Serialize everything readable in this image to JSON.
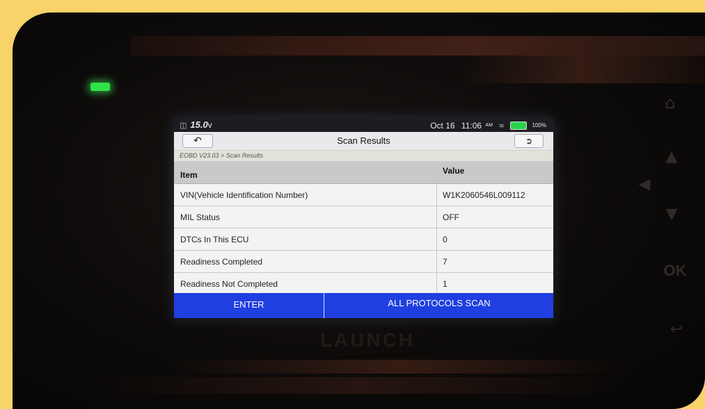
{
  "device": {
    "brand": "LAUNCH",
    "led_color": "#34e24a",
    "buttons": [
      {
        "name": "home",
        "icon": "home-icon",
        "glyph": "⌂"
      },
      {
        "name": "up",
        "icon": "arrow-up-icon",
        "glyph": "▲"
      },
      {
        "name": "left",
        "icon": "arrow-left-icon",
        "glyph": "◀"
      },
      {
        "name": "down",
        "icon": "arrow-down-icon",
        "glyph": "▼"
      },
      {
        "name": "ok",
        "label": "OK"
      },
      {
        "name": "back",
        "icon": "back-arrow-icon",
        "glyph": "↩"
      }
    ]
  },
  "screen": {
    "status_bar": {
      "battery_icon": "car-battery-icon",
      "voltage": "15.0",
      "voltage_unit": "v",
      "date": "Oct 16",
      "time": "11:06",
      "ampm": "AM",
      "wifi_icon": "wifi-icon",
      "battery_level": "100%",
      "battery_color": "#2bd24a"
    },
    "title_bar": {
      "back_icon": "back-arrow-icon",
      "title": "Scan Results",
      "exit_icon": "exit-icon"
    },
    "breadcrumb": "EOBD V23.03 > Scan Results",
    "table": {
      "columns": [
        "Item",
        "Value"
      ],
      "rows": [
        {
          "item": "VIN(Vehicle Identification Number)",
          "value": "W1K2060546L009112"
        },
        {
          "item": "MIL Status",
          "value": "OFF"
        },
        {
          "item": "DTCs In This ECU",
          "value": "0"
        },
        {
          "item": "Readiness Completed",
          "value": "7"
        },
        {
          "item": "Readiness Not Completed",
          "value": "1"
        }
      ]
    },
    "bottom_bar": {
      "enter_label": "ENTER",
      "scan_label": "ALL PROTOCOLS SCAN",
      "accent_color": "#1f3fe0"
    }
  }
}
